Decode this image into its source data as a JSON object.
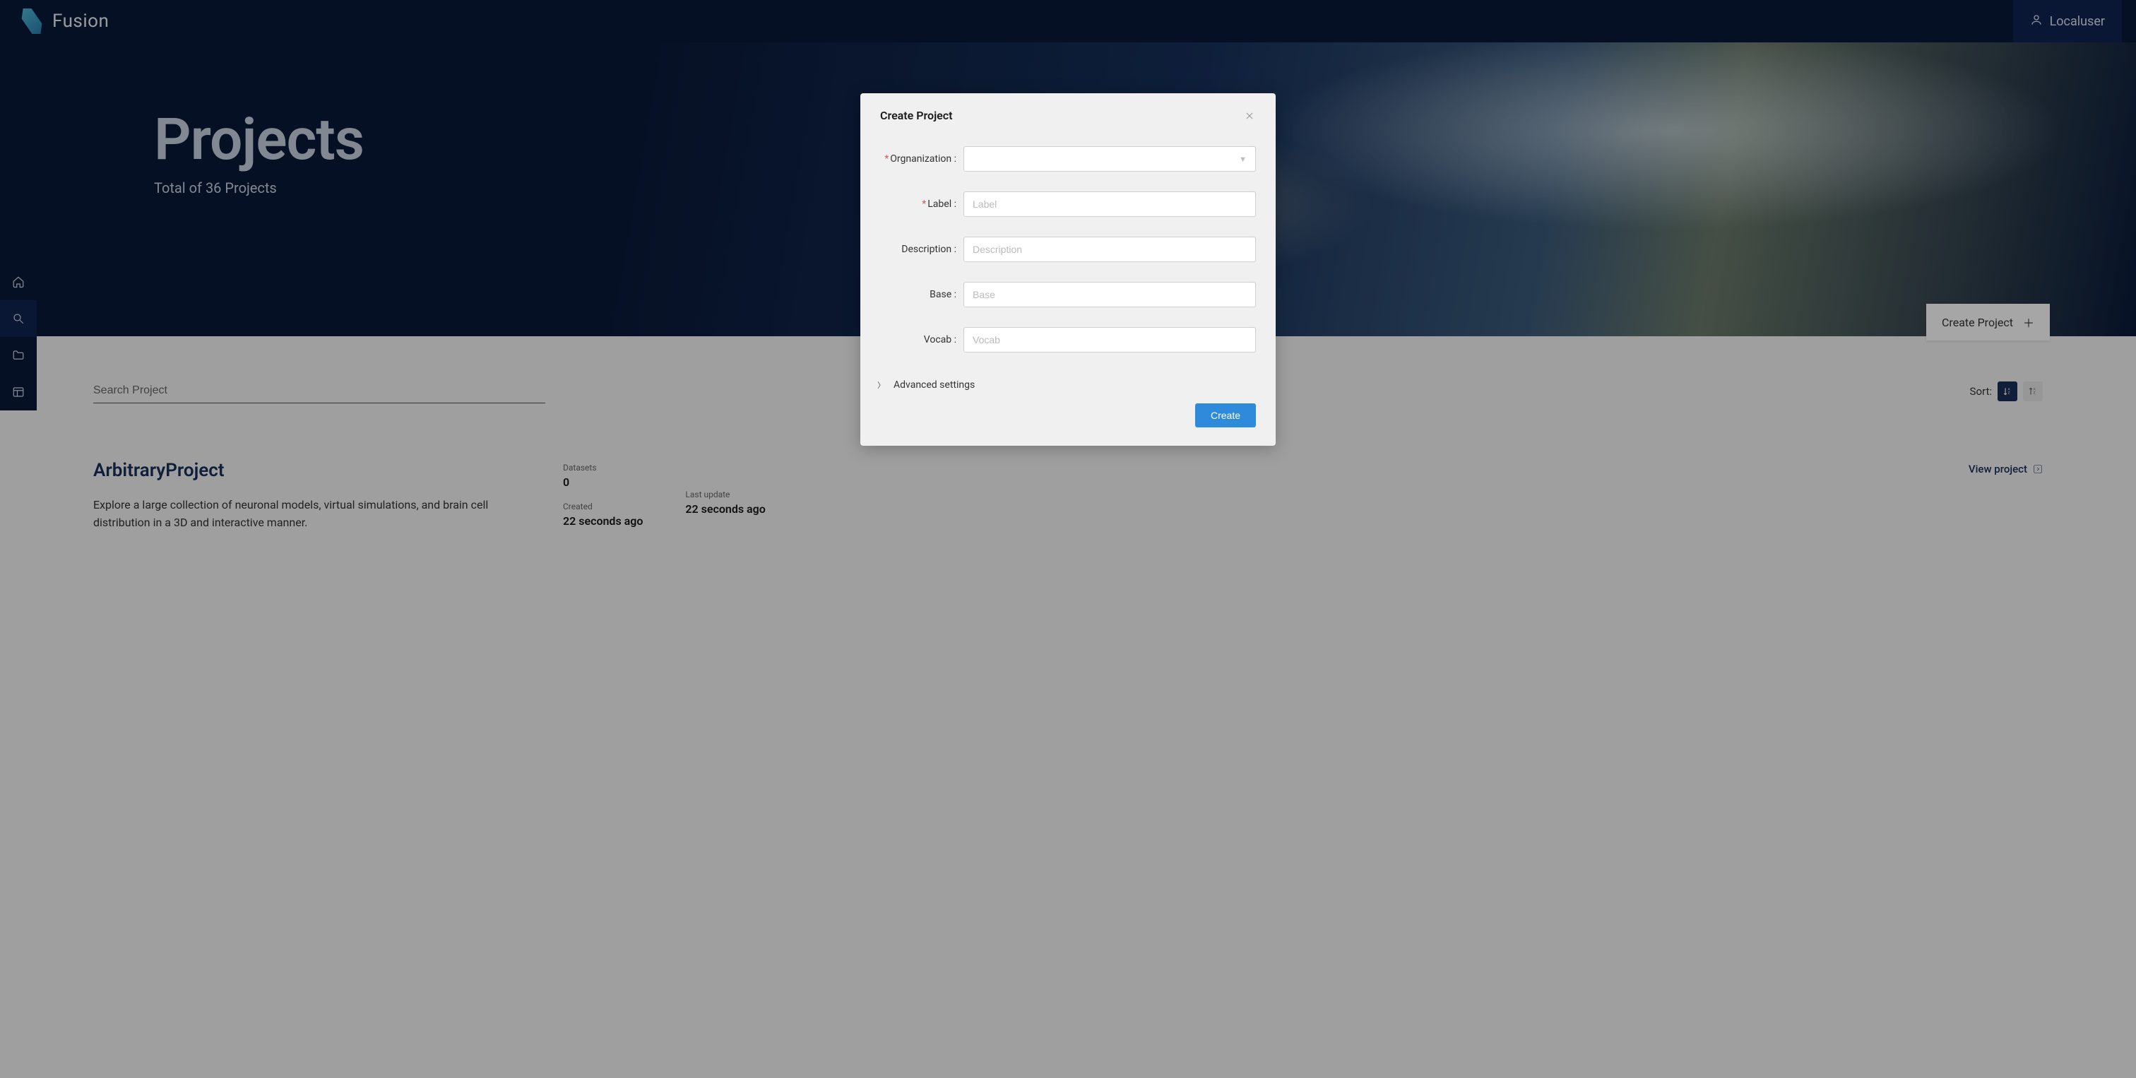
{
  "header": {
    "app_name": "Fusion",
    "user_name": "Localuser"
  },
  "hero": {
    "title": "Projects",
    "subtitle": "Total of 36 Projects"
  },
  "sidenav": {
    "items": [
      {
        "name": "home"
      },
      {
        "name": "search"
      },
      {
        "name": "folder"
      },
      {
        "name": "panel"
      }
    ]
  },
  "toolbar": {
    "create_project_label": "Create Project",
    "search_placeholder": "Search Project",
    "sort_label": "Sort:"
  },
  "projects": [
    {
      "title": "ArbitraryProject",
      "description": "Explore a large collection of neuronal models, virtual simulations, and brain cell distribution in a 3D and interactive manner.",
      "datasets_label": "Datasets",
      "datasets_value": "0",
      "created_label": "Created",
      "created_value": "22 seconds ago",
      "updated_label": "Last update",
      "updated_value": "22 seconds ago",
      "view_label": "View project"
    }
  ],
  "modal": {
    "title": "Create Project",
    "fields": {
      "organization_label": "Orgnanization",
      "label_label": "Label",
      "label_placeholder": "Label",
      "description_label": "Description",
      "description_placeholder": "Description",
      "base_label": "Base",
      "base_placeholder": "Base",
      "vocab_label": "Vocab",
      "vocab_placeholder": "Vocab"
    },
    "advanced_label": "Advanced settings",
    "create_button": "Create"
  }
}
